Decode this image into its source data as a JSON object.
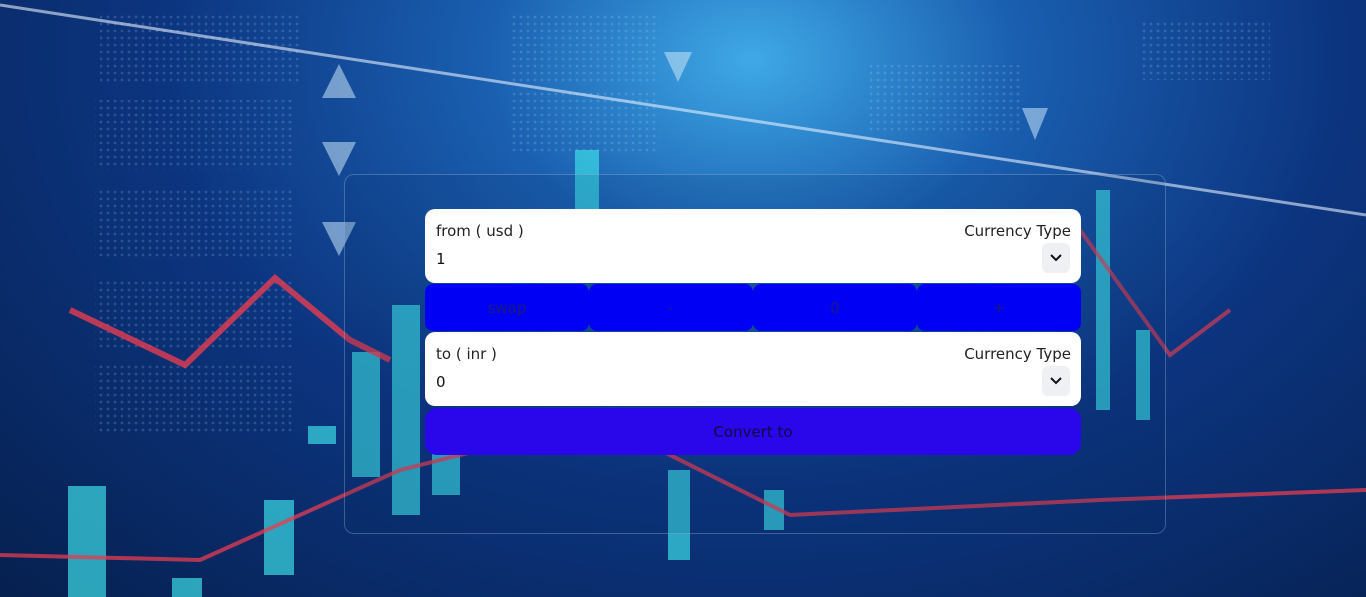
{
  "from_card": {
    "label": "from ( usd )",
    "currency_type_label": "Currency Type",
    "value": "1"
  },
  "controls": {
    "swap": "swap",
    "minus": "-",
    "zero": "0",
    "plus": "+"
  },
  "to_card": {
    "label": "to ( inr )",
    "currency_type_label": "Currency Type",
    "value": "0"
  },
  "convert_button": {
    "label": "Convert to"
  },
  "icons": {
    "select_arrow": "chevron-down-icon"
  },
  "colors": {
    "control_blue": "#0000f5",
    "convert_blue": "#2a06ea"
  }
}
